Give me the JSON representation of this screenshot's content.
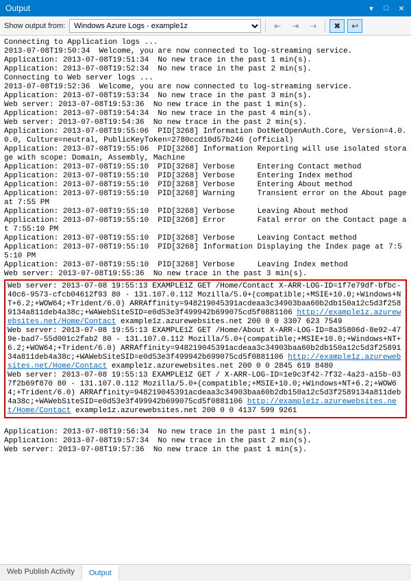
{
  "window": {
    "title": "Output"
  },
  "toolbar": {
    "label": "Show output from:",
    "selected": "Windows Azure Logs - example1z"
  },
  "log": {
    "pre": "Connecting to Application logs ...\n2013-07-08T19:50:34  Welcome, you are now connected to log-streaming service.\nApplication: 2013-07-08T19:51:34  No new trace in the past 1 min(s).\nApplication: 2013-07-08T19:52:34  No new trace in the past 2 min(s).\nConnecting to Web server logs ...\n2013-07-08T19:52:36  Welcome, you are now connected to log-streaming service.\nApplication: 2013-07-08T19:53:34  No new trace in the past 3 min(s).\nWeb server: 2013-07-08T19:53:36  No new trace in the past 1 min(s).\nApplication: 2013-07-08T19:54:34  No new trace in the past 4 min(s).\nWeb server: 2013-07-08T19:54:36  No new trace in the past 2 min(s).\nApplication: 2013-07-08T19:55:06  PID[3268] Information DotNetOpenAuth.Core, Version=4.0.0.0, Culture=neutral, PublicKeyToken=2780ccd10d57b246 (official)\nApplication: 2013-07-08T19:55:06  PID[3268] Information Reporting will use isolated storage with scope: Domain, Assembly, Machine\nApplication: 2013-07-08T19:55:10  PID[3268] Verbose     Entering Contact method\nApplication: 2013-07-08T19:55:10  PID[3268] Verbose     Entering Index method\nApplication: 2013-07-08T19:55:10  PID[3268] Verbose     Entering About method\nApplication: 2013-07-08T19:55:10  PID[3268] Warning     Transient error on the About page at 7:55 PM\nApplication: 2013-07-08T19:55:10  PID[3268] Verbose     Leaving About method\nApplication: 2013-07-08T19:55:10  PID[3268] Error       Fatal error on the Contact page at 7:55:10 PM\nApplication: 2013-07-08T19:55:10  PID[3268] Verbose     Leaving Contact method\nApplication: 2013-07-08T19:55:10  PID[3268] Information Displaying the Index page at 7:55:10 PM\nApplication: 2013-07-08T19:55:10  PID[3268] Verbose     Leaving Index method\nWeb server: 2013-07-08T19:55:36  No new trace in the past 3 min(s).",
    "box": {
      "seg1": "Web server: 2013-07-08 19:55:13 EXAMPLE1Z GET /Home/Contact X-ARR-LOG-ID=1f7e79df-bfbc-40c6-9573-cfcb04612f93 80 - 131.107.0.112 Mozilla/5.0+(compatible;+MSIE+10.0;+Windows+NT+6.2;+WOW64;+Trident/6.0) ARRAffinity=948219045391acdeaa3c34903baa60b2db150a12c5d3f2589134a811deb4a38c;+WAWebSiteSID=e0d53e3f499942b699075cd5f0881106 ",
      "link1": "http://example1z.azurewebsites.net/Home/Contact",
      "seg2": " example1z.azurewebsites.net 200 0 0 3307 623 7549\nWeb server: 2013-07-08 19:55:13 EXAMPLE1Z GET /Home/About X-ARR-LOG-ID=8a35806d-8e92-479e-bad7-55d001c2fab2 80 - 131.107.0.112 Mozilla/5.0+(compatible;+MSIE+10.0;+Windows+NT+6.2;+WOW64;+Trident/6.0) ARRAffinity=948219045391acdeaa3c34903baa60b2db150a12c5d3f2589134a811deb4a38c;+WAWebSiteSID=e0d53e3f499942b699075cd5f0881106 ",
      "link2": "http://example1z.azurewebsites.net/Home/Contact",
      "seg3": " example1z.azurewebsites.net 200 0 0 2845 619 8480\nWeb server: 2013-07-08 19:55:13 EXAMPLE1Z GET / X-ARR-LOG-ID=1e9c3f42-7f32-4a23-a15b-037f2b69f870 80 - 131.107.0.112 Mozilla/5.0+(compatible;+MSIE+10.0;+Windows+NT+6.2;+WOW64;+Trident/6.0) ARRAffinity=948219045391acdeaa3c34903baa60b2db150a12c5d3f2589134a811deb4a38c;+WAWebSiteSID=e0d53e3f499942b699075cd5f0881106 ",
      "link3": "http://example1z.azurewebsites.net/Home/Contact",
      "seg4": " example1z.azurewebsites.net 200 0 0 4137 599 9261"
    },
    "post": "Application: 2013-07-08T19:56:34  No new trace in the past 1 min(s).\nApplication: 2013-07-08T19:57:34  No new trace in the past 2 min(s).\nWeb server: 2013-07-08T19:57:36  No new trace in the past 1 min(s).\n"
  },
  "tabs": {
    "publish": "Web Publish Activity",
    "output": "Output"
  }
}
